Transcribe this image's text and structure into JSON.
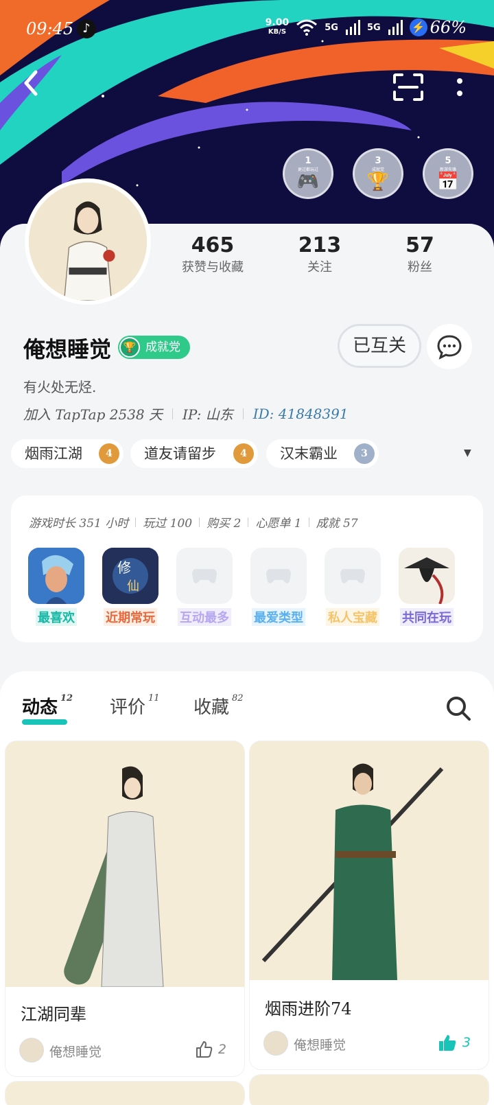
{
  "status": {
    "time": "09:45",
    "net_speed": "9.00",
    "net_unit": "KB/S",
    "signal1": "5G",
    "signal2": "5G",
    "battery": "66%"
  },
  "colors": {
    "accent": "#18c4b8",
    "achievement": "#2fc98a",
    "banner_bg": "#0f0c3f"
  },
  "medals": [
    {
      "num": "1",
      "caption": "更过都玩过",
      "icon": "gamepad-icon"
    },
    {
      "num": "3",
      "caption": "成就党",
      "icon": "trophy-icon"
    },
    {
      "num": "5",
      "caption": "新游先锋",
      "icon": "calendar-icon"
    }
  ],
  "stats": [
    {
      "value": "465",
      "label": "获赞与收藏"
    },
    {
      "value": "213",
      "label": "关注"
    },
    {
      "value": "57",
      "label": "粉丝"
    }
  ],
  "profile": {
    "name": "俺想睡觉",
    "badge": "成就党",
    "follow_state": "已互关",
    "bio": "有火处无烃.",
    "joined": "加入 TapTap 2538 天",
    "ip": "IP:  山东",
    "id": "ID:  41848391"
  },
  "tags": [
    {
      "name": "烟雨江湖",
      "level": "4"
    },
    {
      "name": "道友请留步",
      "level": "4"
    },
    {
      "name": "汉末霸业",
      "level": "3"
    }
  ],
  "game_stats": [
    "游戏时长 351 小时",
    "玩过 100",
    "购买 2",
    "心愿单 1",
    "成就 57"
  ],
  "games": [
    {
      "label": "最喜欢",
      "color": "#17b8a6",
      "bg": "#e2f7f3"
    },
    {
      "label": "近期常玩",
      "color": "#e8693b",
      "bg": "#fdeee6"
    },
    {
      "label": "互动最多",
      "color": "#b6a7f0",
      "bg": "#f1eefc"
    },
    {
      "label": "最爱类型",
      "color": "#5ab0f0",
      "bg": "#e8f4fd"
    },
    {
      "label": "私人宝藏",
      "color": "#f5c46a",
      "bg": "#fdf6e6"
    },
    {
      "label": "共同在玩",
      "color": "#7a68d8",
      "bg": "#efedfb"
    }
  ],
  "tabs": [
    {
      "label": "动态",
      "count": "12"
    },
    {
      "label": "评价",
      "count": "11"
    },
    {
      "label": "收藏",
      "count": "82"
    }
  ],
  "posts": [
    {
      "title": "江湖同辈",
      "author": "俺想睡觉",
      "likes": "2"
    },
    {
      "title": "烟雨进阶74",
      "author": "俺想睡觉",
      "likes": "3"
    }
  ]
}
